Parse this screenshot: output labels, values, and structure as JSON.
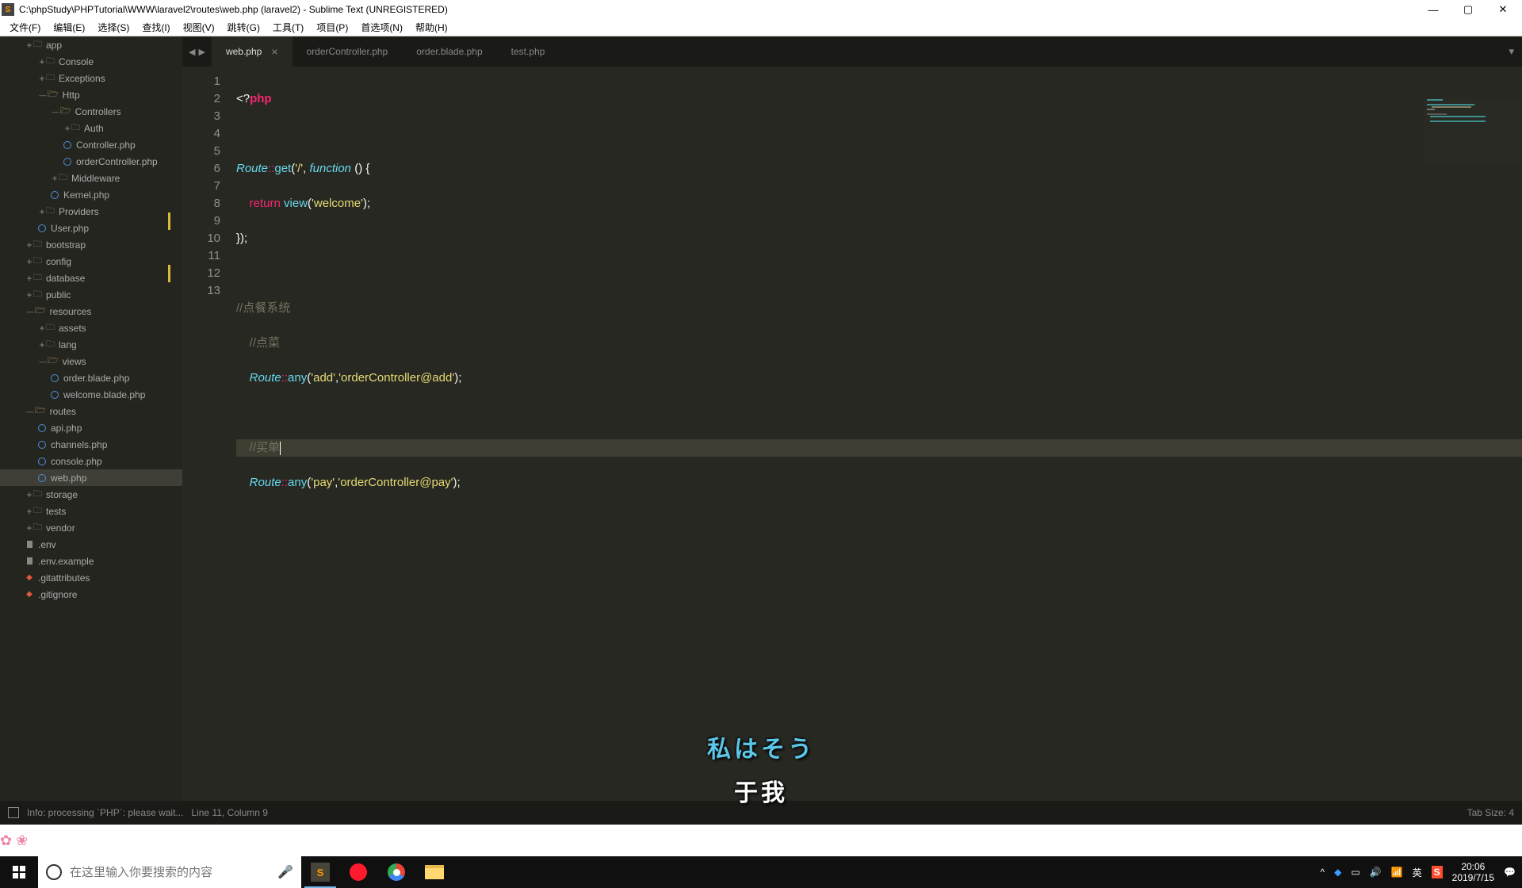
{
  "window": {
    "title": "C:\\phpStudy\\PHPTutorial\\WWW\\laravel2\\routes\\web.php (laravel2) - Sublime Text (UNREGISTERED)"
  },
  "menu": [
    "文件(F)",
    "编辑(E)",
    "选择(S)",
    "查找(I)",
    "视图(V)",
    "跳转(G)",
    "工具(T)",
    "项目(P)",
    "首选项(N)",
    "帮助(H)"
  ],
  "sidebar": {
    "items": [
      {
        "depth": 2,
        "type": "folderPlus",
        "label": "app"
      },
      {
        "depth": 3,
        "type": "folderPlus",
        "label": "Console"
      },
      {
        "depth": 3,
        "type": "folderPlus",
        "label": "Exceptions"
      },
      {
        "depth": 3,
        "type": "folderOpen",
        "label": "Http"
      },
      {
        "depth": 4,
        "type": "folderOpen",
        "label": "Controllers"
      },
      {
        "depth": 5,
        "type": "folderPlus",
        "label": "Auth"
      },
      {
        "depth": 5,
        "type": "php",
        "label": "Controller.php"
      },
      {
        "depth": 5,
        "type": "php",
        "label": "orderController.php"
      },
      {
        "depth": 4,
        "type": "folderPlus",
        "label": "Middleware"
      },
      {
        "depth": 4,
        "type": "php",
        "label": "Kernel.php"
      },
      {
        "depth": 3,
        "type": "folderPlus",
        "label": "Providers"
      },
      {
        "depth": 3,
        "type": "php",
        "label": "User.php"
      },
      {
        "depth": 2,
        "type": "folderPlus",
        "label": "bootstrap"
      },
      {
        "depth": 2,
        "type": "folderPlus",
        "label": "config"
      },
      {
        "depth": 2,
        "type": "folderPlus",
        "label": "database"
      },
      {
        "depth": 2,
        "type": "folderPlus",
        "label": "public"
      },
      {
        "depth": 2,
        "type": "folderOpen",
        "label": "resources"
      },
      {
        "depth": 3,
        "type": "folderPlus",
        "label": "assets"
      },
      {
        "depth": 3,
        "type": "folderPlus",
        "label": "lang"
      },
      {
        "depth": 3,
        "type": "folderOpen",
        "label": "views"
      },
      {
        "depth": 4,
        "type": "php",
        "label": "order.blade.php"
      },
      {
        "depth": 4,
        "type": "php",
        "label": "welcome.blade.php"
      },
      {
        "depth": 2,
        "type": "folderOpen",
        "label": "routes"
      },
      {
        "depth": 3,
        "type": "php",
        "label": "api.php"
      },
      {
        "depth": 3,
        "type": "php",
        "label": "channels.php"
      },
      {
        "depth": 3,
        "type": "php",
        "label": "console.php"
      },
      {
        "depth": 3,
        "type": "php",
        "label": "web.php",
        "selected": true
      },
      {
        "depth": 2,
        "type": "folderPlus",
        "label": "storage"
      },
      {
        "depth": 2,
        "type": "folderPlus",
        "label": "tests"
      },
      {
        "depth": 2,
        "type": "folderPlus",
        "label": "vendor"
      },
      {
        "depth": 2,
        "type": "generic",
        "label": ".env"
      },
      {
        "depth": 2,
        "type": "generic",
        "label": ".env.example"
      },
      {
        "depth": 2,
        "type": "git",
        "label": ".gitattributes"
      },
      {
        "depth": 2,
        "type": "git",
        "label": ".gitignore"
      }
    ]
  },
  "tabs": {
    "nav_back": "◀",
    "nav_fwd": "▶",
    "items": [
      {
        "label": "web.php",
        "active": true,
        "close": "×"
      },
      {
        "label": "orderController.php"
      },
      {
        "label": "order.blade.php"
      },
      {
        "label": "test.php"
      }
    ],
    "overflow": "▾"
  },
  "code": {
    "lines": [
      {
        "n": 1
      },
      {
        "n": 2
      },
      {
        "n": 3
      },
      {
        "n": 4
      },
      {
        "n": 5
      },
      {
        "n": 6
      },
      {
        "n": 7
      },
      {
        "n": 8
      },
      {
        "n": 9,
        "mod": true
      },
      {
        "n": 10
      },
      {
        "n": 11,
        "current": true
      },
      {
        "n": 12,
        "mod": true
      },
      {
        "n": 13
      }
    ],
    "t": {
      "phpopen": "<?",
      "php": "php",
      "route": "Route",
      "dbl": "::",
      "get": "get",
      "any": "any",
      "lpar": "(",
      "rpar": ")",
      "slash": "'/'",
      "comma": ", ",
      "comma2": ",",
      "func": "function",
      "space": " () {",
      "indent": "    ",
      "indent2": "        ",
      "return": "return",
      "view": " view",
      "welcome": "'welcome'",
      "semi": ";",
      "closeblk": "});",
      "cmt1": "//点餐系统",
      "cmt2": "//点菜",
      "cmt3": "//买单",
      "add": "'add'",
      "addctl": "'orderController@add'",
      "pay": "'pay'",
      "payctl": "'orderController@pay'"
    }
  },
  "status": {
    "left": "Info: processing `PHP`: please wait...",
    "pos": "Line 11, Column 9",
    "tab": "Tab Size: 4"
  },
  "subtitle": {
    "jp": "私はそう",
    "cn": "于我"
  },
  "taskbar": {
    "search_placeholder": "在这里输入你要搜索的内容",
    "ime": "英",
    "time": "20:06",
    "date": "2019/7/15"
  }
}
